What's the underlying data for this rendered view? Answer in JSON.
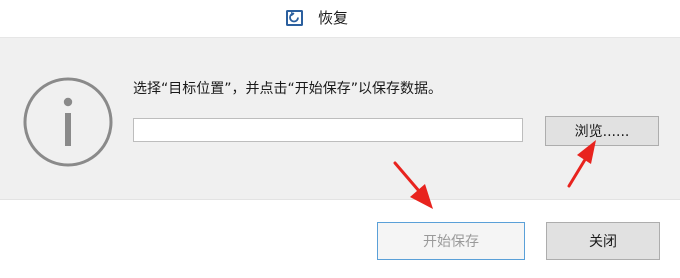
{
  "window": {
    "title": "恢复",
    "icon": "restore-icon"
  },
  "content": {
    "icon": "info-icon",
    "message": "选择“目标位置”，并点击“开始保存”以保存数据。",
    "path_value": "",
    "path_placeholder": ""
  },
  "buttons": {
    "browse_label": "浏览......",
    "start_label": "开始保存",
    "close_label": "关闭"
  },
  "annotations": {
    "arrow_color": "#e8231e"
  },
  "colors": {
    "content_background": "#f0f0f0",
    "info_icon": "#8a8a8a",
    "focus_border": "#5aa0d8",
    "disabled_text": "#9a9a9a"
  }
}
